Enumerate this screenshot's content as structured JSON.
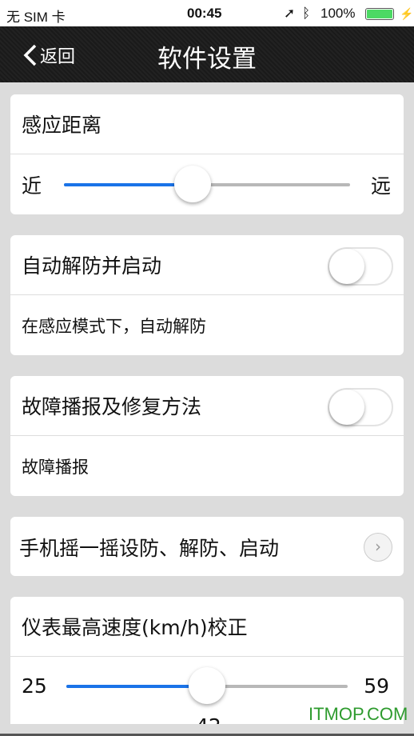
{
  "status_bar": {
    "carrier": "无 SIM 卡",
    "time": "00:45",
    "battery": "100%",
    "battery_level": 100,
    "battery_color": "#4cd964"
  },
  "nav": {
    "back_label": "返回",
    "title": "软件设置"
  },
  "sensing": {
    "title": "感应距离",
    "min_label": "近",
    "max_label": "远",
    "value_percent": 45
  },
  "auto_disarm": {
    "title": "自动解防并启动",
    "enabled": false,
    "description": "在感应模式下，自动解防"
  },
  "fault_report": {
    "title": "故障播报及修复方法",
    "enabled": false,
    "description": "故障播报"
  },
  "shake": {
    "title": "手机摇一摇设防、解防、启动"
  },
  "speed": {
    "title": "仪表最高速度(km/h)校正",
    "min": "25",
    "max": "59",
    "value": "42"
  },
  "watermark": "ITMOP.COM",
  "accent": "#1a73e8"
}
